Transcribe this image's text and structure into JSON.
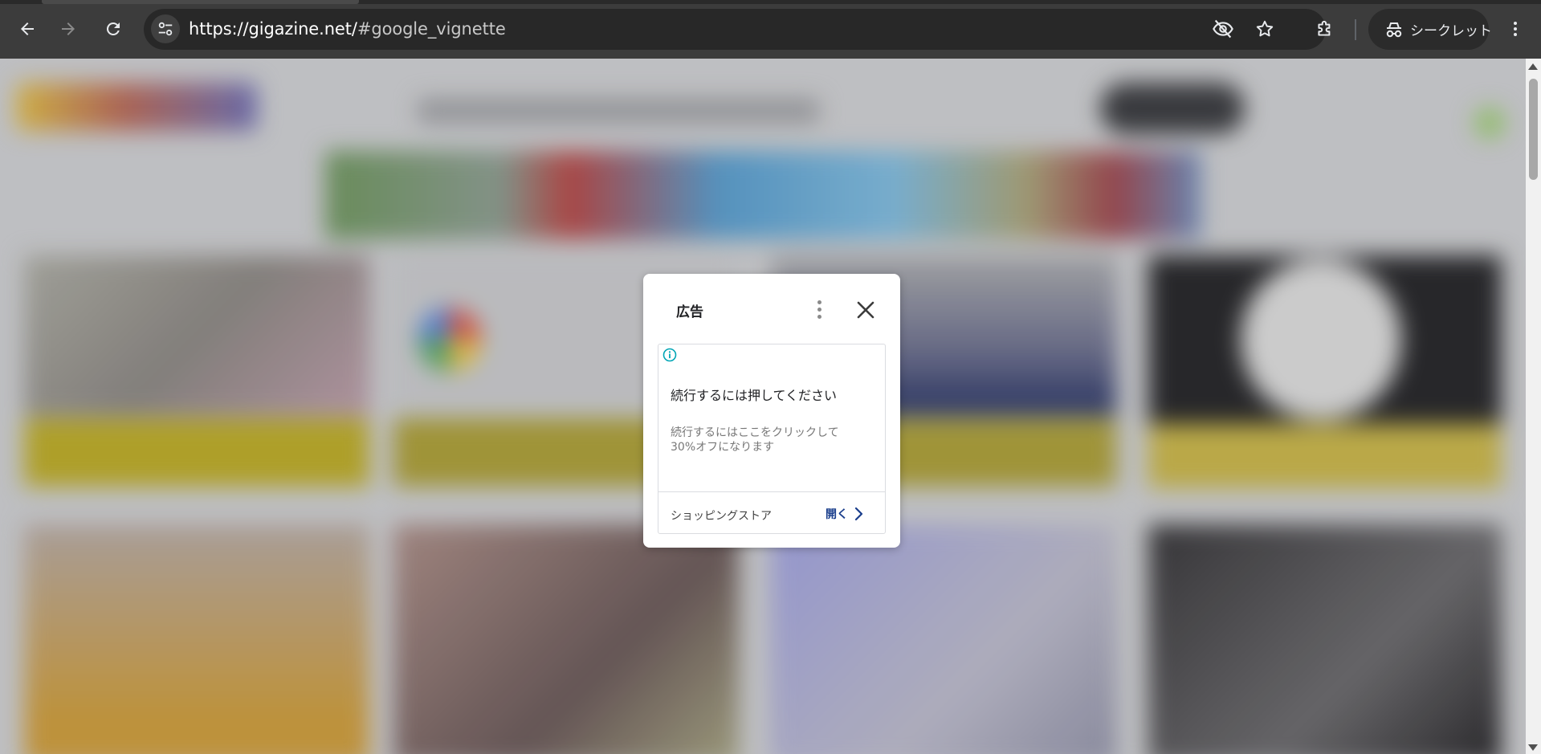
{
  "browser": {
    "url_host": "https://gigazine.net/",
    "url_rest": "#google_vignette",
    "incognito_label": "シークレット"
  },
  "ad": {
    "title": "広告",
    "headline": "続行するには押してください",
    "description": "続行するにはここをクリックして30%オフになります",
    "advertiser": "ショッピングストア",
    "cta": "開く"
  },
  "colors": {
    "toolbar": "#3c3c3c",
    "omnibox": "#282828",
    "ad_cta": "#1a3e8c",
    "info_icon": "#00a5b5"
  }
}
